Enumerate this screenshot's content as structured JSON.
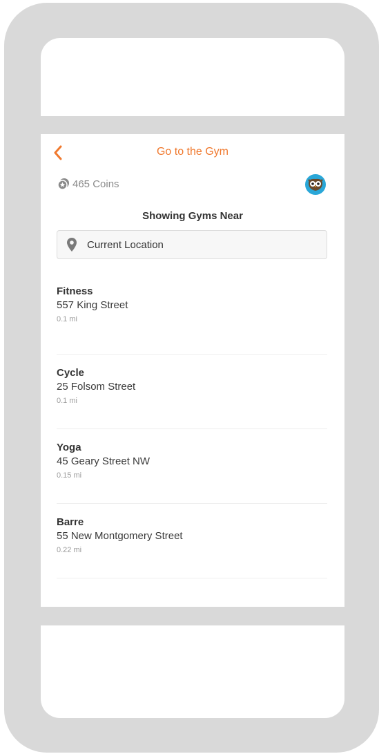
{
  "nav": {
    "title": "Go to the Gym",
    "back_icon": "chevron-left-icon",
    "accent_color": "#f0792e"
  },
  "coins": {
    "label": "465 Coins",
    "icon": "coin-icon"
  },
  "profile": {
    "icon": "owl-avatar-icon"
  },
  "search": {
    "heading": "Showing Gyms Near",
    "value": "Current Location",
    "icon": "location-pin-icon"
  },
  "gyms": [
    {
      "name": "Fitness",
      "address": "557 King Street",
      "distance": "0.1 mi"
    },
    {
      "name": "Cycle",
      "address": "25 Folsom Street",
      "distance": "0.1 mi"
    },
    {
      "name": "Yoga",
      "address": "45 Geary Street NW",
      "distance": "0.15 mi"
    },
    {
      "name": "Barre",
      "address": "55 New Montgomery Street",
      "distance": "0.22 mi"
    }
  ]
}
